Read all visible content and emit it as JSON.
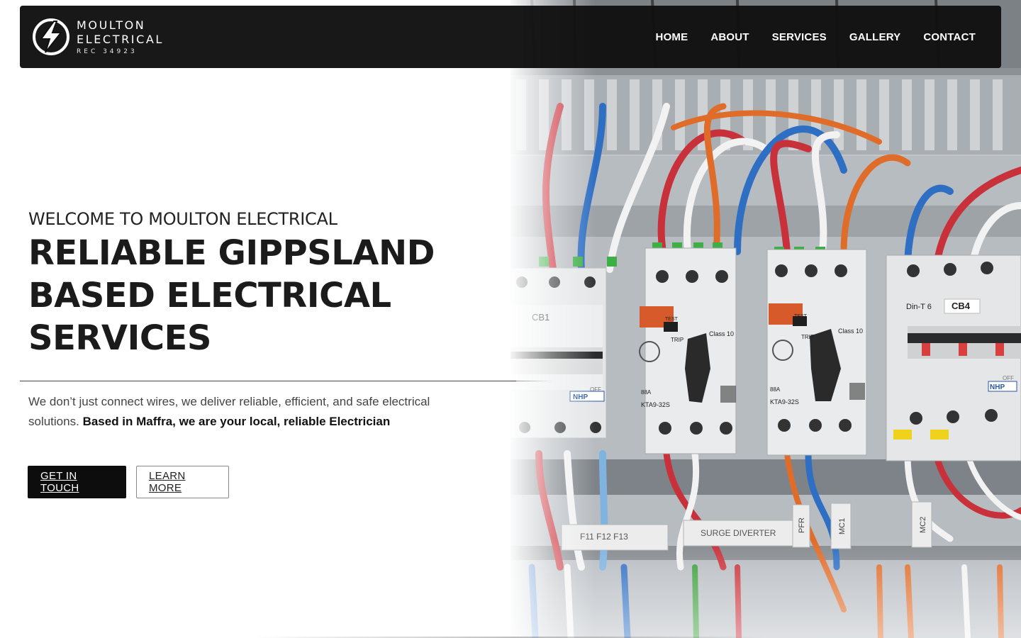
{
  "brand": {
    "name_line1": "MOULTON",
    "name_line2": "ELECTRICAL",
    "rec": "REC 34923",
    "logo_icon": "lightning-bolt-icon"
  },
  "nav": {
    "items": [
      {
        "label": "HOME"
      },
      {
        "label": "ABOUT"
      },
      {
        "label": "SERVICES"
      },
      {
        "label": "GALLERY"
      },
      {
        "label": "CONTACT"
      }
    ]
  },
  "hero": {
    "welcome": "WELCOME TO MOULTON ELECTRICAL",
    "headline": "RELIABLE GIPPSLAND BASED ELECTRICAL SERVICES",
    "lede_text": "We don’t just connect wires, we deliver reliable, efficient, and safe electrical solutions.",
    "lede_bold": "Based in Maffra, we are your local, reliable Electrician",
    "primary_button": "GET IN TOUCH",
    "secondary_button": "LEARN MORE",
    "photo_labels": {
      "cb1": "CB1",
      "cb4": "CB4",
      "dint6": "Din-T 6",
      "class10_a": "Class 10",
      "class10_b": "Class 10",
      "kta_a": "KTA9-32S",
      "kta_b": "KTA9-32S",
      "test_a": "TEST",
      "test_b": "TEST",
      "trip_a": "TRIP",
      "trip_b": "TRIP",
      "nhp_a": "NHP",
      "nhp_b": "NHP",
      "off_a": "OFF",
      "off_b": "OFF",
      "amp_a": "88A",
      "amp_b": "88A",
      "f_labels": "F11   F12   F13",
      "surge": "SURGE DIVERTER",
      "pfr": "PFR",
      "mc1": "MC1",
      "mc2": "MC2"
    }
  },
  "colors": {
    "header_bg": "#111111",
    "primary_button_bg": "#0d0d0d",
    "text_dark": "#1b1b1b"
  }
}
